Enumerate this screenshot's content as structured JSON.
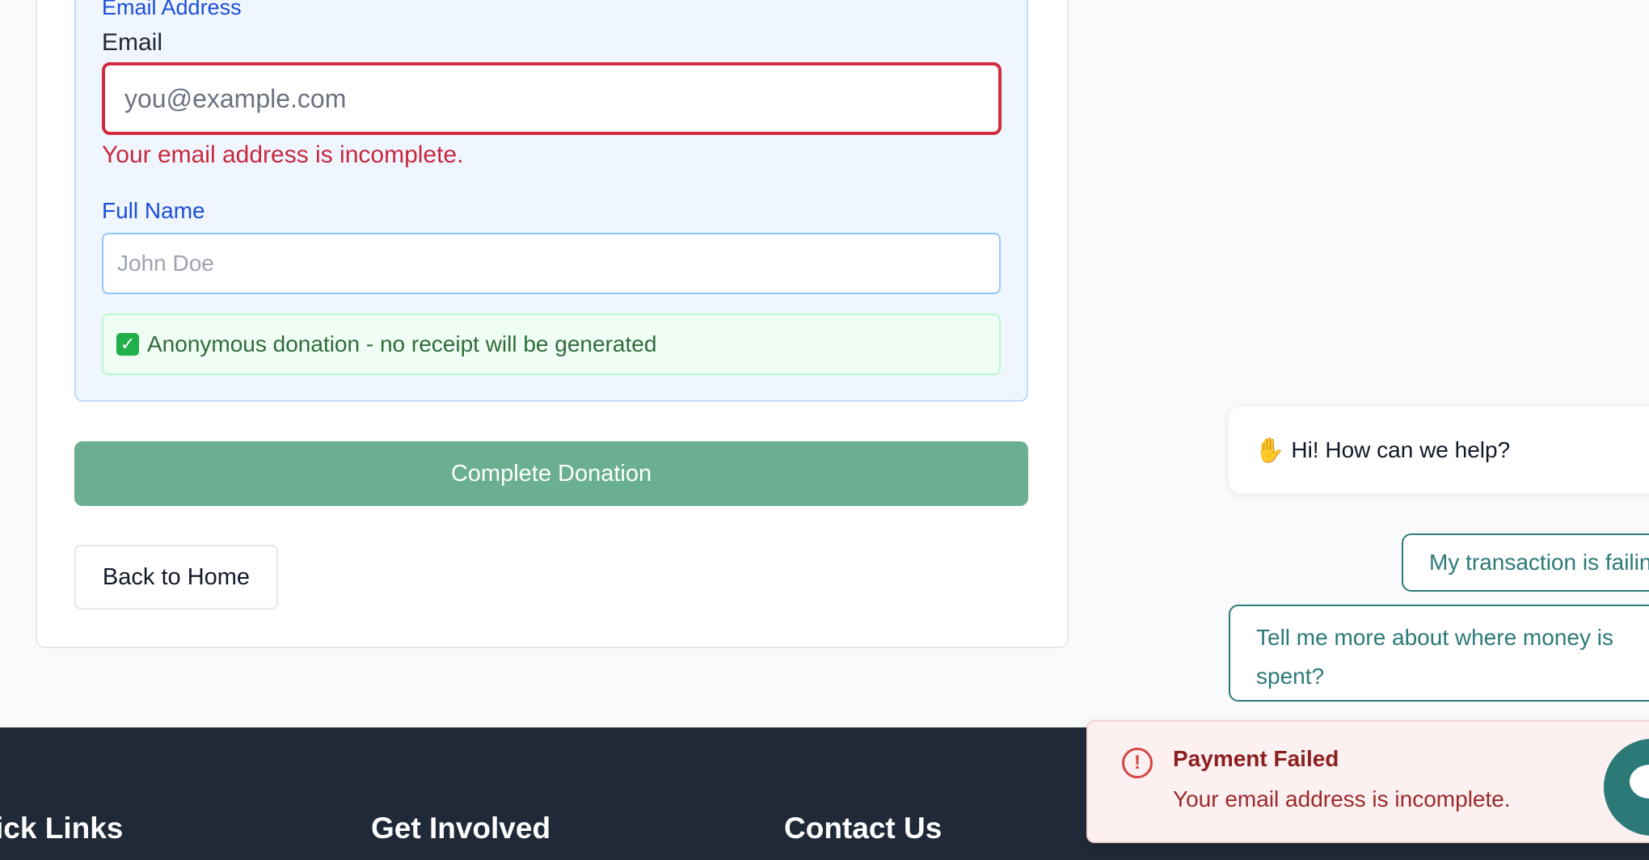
{
  "form": {
    "section_heading": "Email Address",
    "email_label": "Email",
    "email_placeholder": "you@example.com",
    "email_error": "Your email address is incomplete.",
    "name_label": "Full Name",
    "name_placeholder": "John Doe",
    "anonymous_note": "Anonymous donation - no receipt will be generated",
    "complete_button": "Complete Donation",
    "back_button": "Back to Home"
  },
  "footer": {
    "headings": [
      "ick Links",
      "Get Involved",
      "Contact Us"
    ]
  },
  "chat": {
    "greeting": "Hi! How can we help?",
    "options": [
      "My transaction is failin",
      "Tell me more about where money is spent?"
    ]
  },
  "toast": {
    "title": "Payment Failed",
    "message": "Your email address is incomplete."
  },
  "colors": {
    "error": "#d12b3f",
    "primary_button": "#6baf92",
    "chat_accent": "#2c7a78",
    "footer_bg": "#1f2937"
  },
  "icons": {
    "anonymous_note": "check-box-icon",
    "greeting": "waving-hand-icon",
    "toast": "alert-circle-icon",
    "launcher": "chat-bubble-icon"
  }
}
